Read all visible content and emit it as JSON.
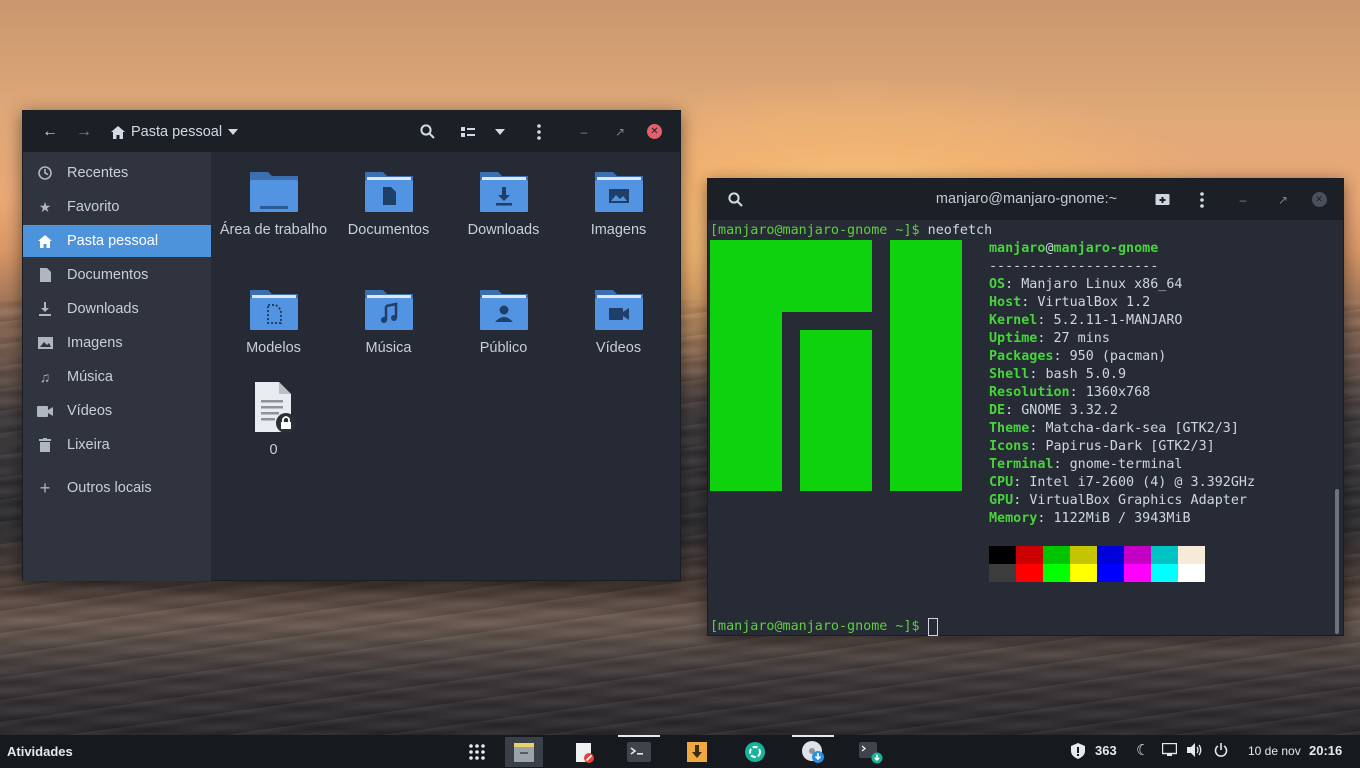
{
  "file_manager": {
    "path_label": "Pasta pessoal",
    "sidebar": [
      {
        "label": "Recentes",
        "icon": "clock-icon"
      },
      {
        "label": "Favorito",
        "icon": "star-icon"
      },
      {
        "label": "Pasta pessoal",
        "icon": "home-icon",
        "active": true
      },
      {
        "label": "Documentos",
        "icon": "document-icon"
      },
      {
        "label": "Downloads",
        "icon": "download-icon"
      },
      {
        "label": "Imagens",
        "icon": "image-icon"
      },
      {
        "label": "Música",
        "icon": "music-icon"
      },
      {
        "label": "Vídeos",
        "icon": "video-icon"
      },
      {
        "label": "Lixeira",
        "icon": "trash-icon"
      },
      {
        "label": "Outros locais",
        "icon": "plus-icon"
      }
    ],
    "folders": [
      {
        "label": "Área de trabalho",
        "icon": "desktop-folder-icon"
      },
      {
        "label": "Documentos",
        "icon": "documents-folder-icon"
      },
      {
        "label": "Downloads",
        "icon": "downloads-folder-icon"
      },
      {
        "label": "Imagens",
        "icon": "images-folder-icon"
      },
      {
        "label": "Modelos",
        "icon": "templates-folder-icon"
      },
      {
        "label": "Música",
        "icon": "music-folder-icon"
      },
      {
        "label": "Público",
        "icon": "public-folder-icon"
      },
      {
        "label": "Vídeos",
        "icon": "videos-folder-icon"
      },
      {
        "label": "0",
        "icon": "locked-text-file-icon"
      }
    ]
  },
  "terminal": {
    "title": "manjaro@manjaro-gnome:~",
    "prompt": "[manjaro@manjaro-gnome ~]$",
    "command": "neofetch",
    "user": "manjaro",
    "at": "@",
    "host": "manjaro-gnome",
    "separator": "---------------------",
    "info": [
      {
        "key": "OS",
        "value": "Manjaro Linux x86_64"
      },
      {
        "key": "Host",
        "value": "VirtualBox 1.2"
      },
      {
        "key": "Kernel",
        "value": "5.2.11-1-MANJARO"
      },
      {
        "key": "Uptime",
        "value": "27 mins"
      },
      {
        "key": "Packages",
        "value": "950 (pacman)"
      },
      {
        "key": "Shell",
        "value": "bash 5.0.9"
      },
      {
        "key": "Resolution",
        "value": "1360x768"
      },
      {
        "key": "DE",
        "value": "GNOME 3.32.2"
      },
      {
        "key": "Theme",
        "value": "Matcha-dark-sea [GTK2/3]"
      },
      {
        "key": "Icons",
        "value": "Papirus-Dark [GTK2/3]"
      },
      {
        "key": "Terminal",
        "value": "gnome-terminal"
      },
      {
        "key": "CPU",
        "value": "Intel i7-2600 (4) @ 3.392GHz"
      },
      {
        "key": "GPU",
        "value": "VirtualBox Graphics Adapter"
      },
      {
        "key": "Memory",
        "value": "1122MiB / 3943MiB"
      }
    ],
    "palette_top": [
      "#000000",
      "#cc0000",
      "#00c400",
      "#c4c400",
      "#0000d8",
      "#c400c4",
      "#00c4c4",
      "#f6ead8"
    ],
    "palette_bottom": [
      "#3c3c3c",
      "#ff0000",
      "#00ff00",
      "#ffff00",
      "#0000ff",
      "#ff00ff",
      "#00ffff",
      "#ffffff"
    ],
    "logo_color": "#0fd20f"
  },
  "panel": {
    "activities": "Atividades",
    "security_count": "363",
    "date": "10 de nov",
    "time": "20:16"
  },
  "colors": {
    "accent": "#4c93dc",
    "folder_blue": "#5294e2",
    "terminal_green": "#47d43a"
  }
}
